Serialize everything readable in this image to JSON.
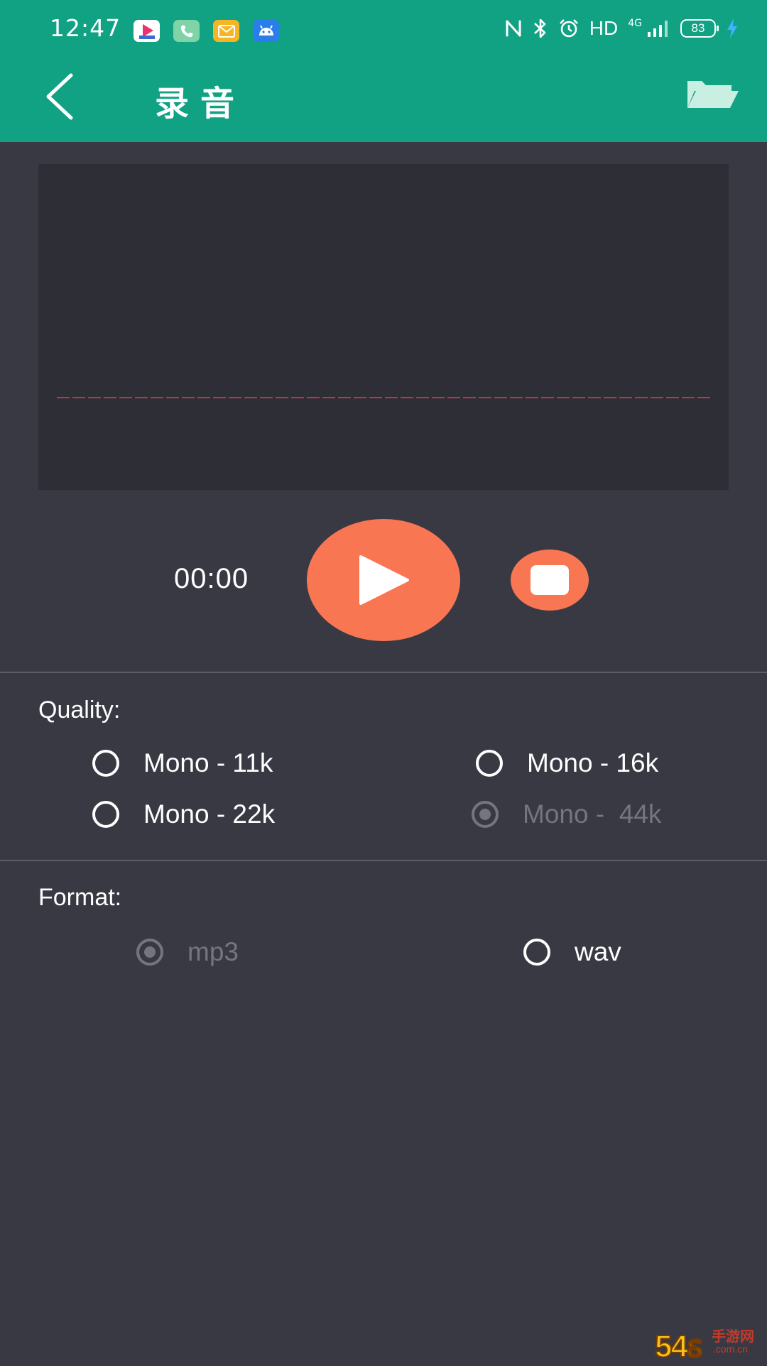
{
  "status_bar": {
    "time": "12:47",
    "network": "4G",
    "hd_label": "HD",
    "battery_level": "83",
    "notification_icons": [
      "video-app-icon",
      "phone-icon",
      "mail-icon",
      "android-icon"
    ]
  },
  "header": {
    "title": "录音",
    "back_icon": "chevron-left-icon",
    "folder_icon": "folder-open-icon",
    "background_color": "#10a283"
  },
  "player": {
    "timer": "00:00",
    "play_icon": "play-icon",
    "stop_icon": "stop-icon",
    "accent_color": "#f97653"
  },
  "quality": {
    "label": "Quality:",
    "options": [
      {
        "label": "Mono - 11k",
        "selected": false,
        "disabled": false
      },
      {
        "label": "Mono - 16k",
        "selected": false,
        "disabled": false
      },
      {
        "label": "Mono - 22k",
        "selected": false,
        "disabled": false
      },
      {
        "label": "Mono -  44k",
        "selected": true,
        "disabled": true
      }
    ]
  },
  "format": {
    "label": "Format:",
    "options": [
      {
        "label": "mp3",
        "selected": true,
        "disabled": true
      },
      {
        "label": "wav",
        "selected": false,
        "disabled": false
      }
    ]
  },
  "watermark": {
    "main": "54ꟙ",
    "side": "手游网",
    "domain": ".com.cn"
  }
}
